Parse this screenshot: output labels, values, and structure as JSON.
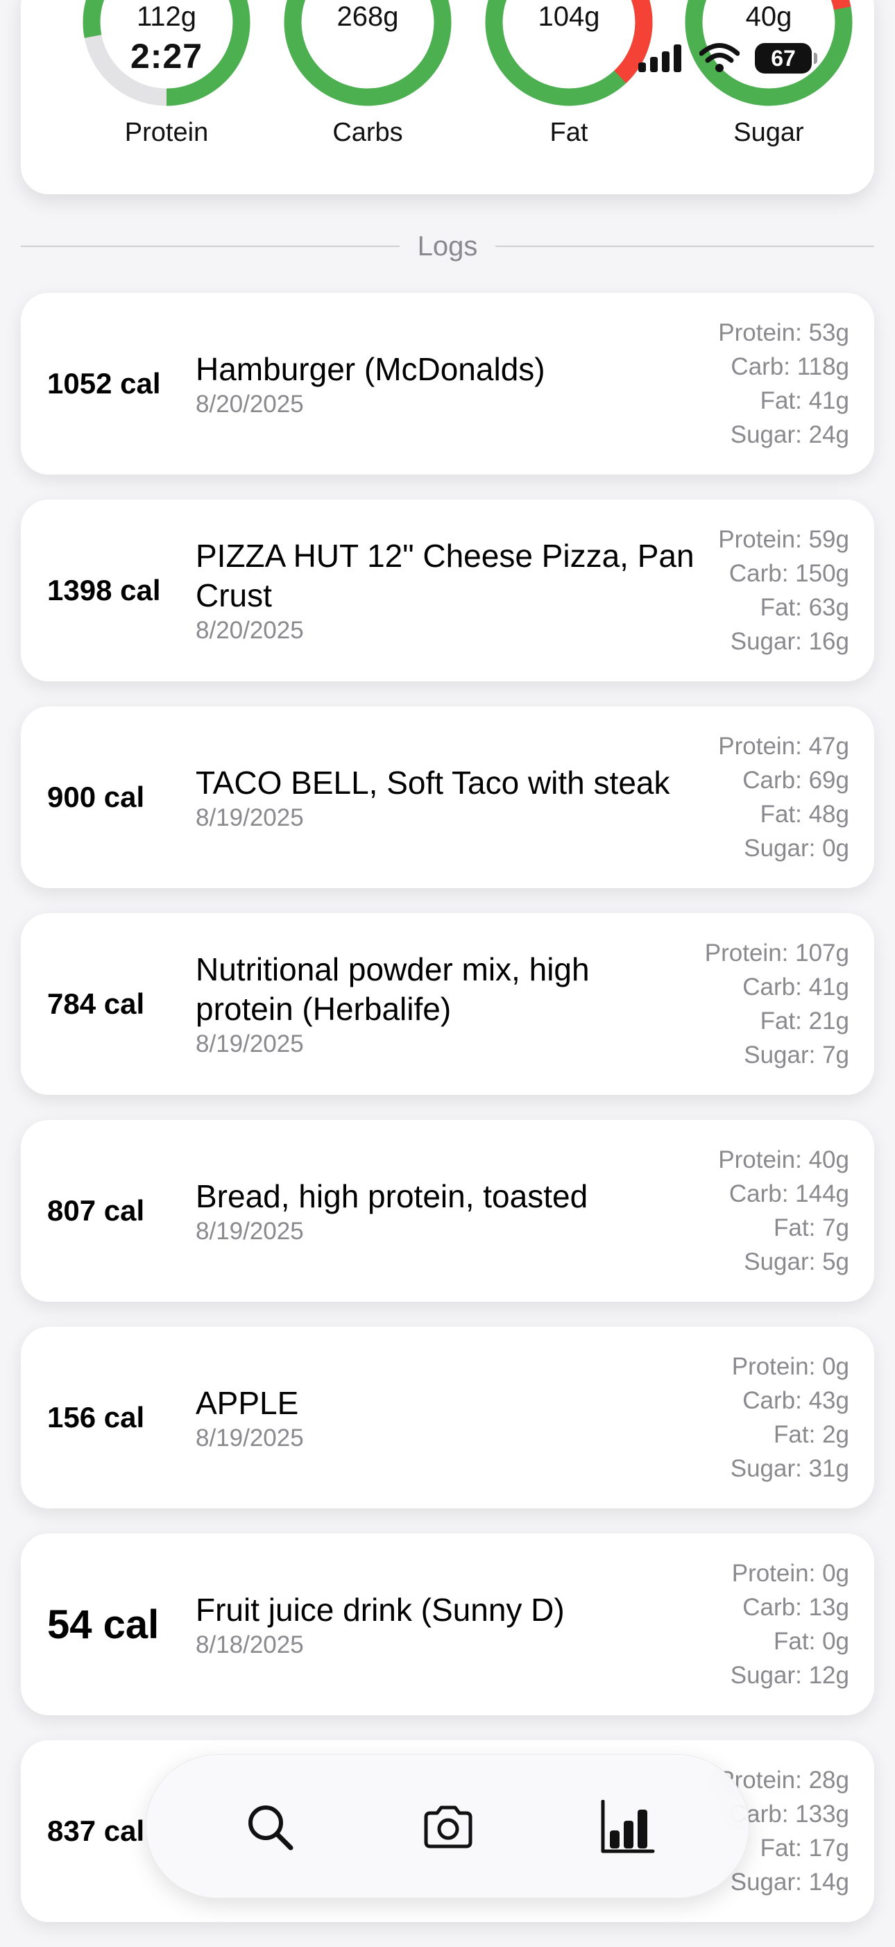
{
  "status_bar": {
    "time": "2:27",
    "battery": "67"
  },
  "macros": [
    {
      "value": "112g",
      "label": "Protein",
      "progress": 0.78,
      "color": "#4caf50",
      "over": false
    },
    {
      "value": "268g",
      "label": "Carbs",
      "progress": 1.0,
      "color": "#4caf50",
      "over": false
    },
    {
      "value": "104g",
      "label": "Fat",
      "progress": 1.0,
      "color": "#4caf50",
      "over": true,
      "over_fraction": 0.38,
      "over_color": "#f44336"
    },
    {
      "value": "40g",
      "label": "Sugar",
      "progress": 1.0,
      "color": "#4caf50",
      "over": true,
      "over_fraction": 0.22,
      "over_color": "#f44336"
    }
  ],
  "logs_header": "Logs",
  "logs": [
    {
      "calories": "1052 cal",
      "name": "Hamburger (McDonalds)",
      "date": "8/20/2025",
      "protein": "Protein: 53g",
      "carb": "Carb: 118g",
      "fat": "Fat: 41g",
      "sugar": "Sugar: 24g"
    },
    {
      "calories": "1398 cal",
      "name": "PIZZA HUT 12\" Cheese Pizza, Pan Crust",
      "date": "8/20/2025",
      "protein": "Protein: 59g",
      "carb": "Carb: 150g",
      "fat": "Fat: 63g",
      "sugar": "Sugar: 16g"
    },
    {
      "calories": "900 cal",
      "name": "TACO BELL, Soft Taco with steak",
      "date": "8/19/2025",
      "protein": "Protein: 47g",
      "carb": "Carb: 69g",
      "fat": "Fat: 48g",
      "sugar": "Sugar: 0g"
    },
    {
      "calories": "784 cal",
      "name": "Nutritional powder mix, high protein (Herbalife)",
      "date": "8/19/2025",
      "protein": "Protein: 107g",
      "carb": "Carb: 41g",
      "fat": "Fat: 21g",
      "sugar": "Sugar: 7g"
    },
    {
      "calories": "807 cal",
      "name": "Bread, high protein, toasted",
      "date": "8/19/2025",
      "protein": "Protein: 40g",
      "carb": "Carb: 144g",
      "fat": "Fat: 7g",
      "sugar": "Sugar: 5g"
    },
    {
      "calories": "156 cal",
      "name": "APPLE",
      "date": "8/19/2025",
      "protein": "Protein: 0g",
      "carb": "Carb: 43g",
      "fat": "Fat: 2g",
      "sugar": "Sugar: 31g"
    },
    {
      "calories": "54 cal",
      "name": "Fruit juice drink (Sunny D)",
      "date": "8/18/2025",
      "protein": "Protein: 0g",
      "carb": "Carb: 13g",
      "fat": "Fat: 0g",
      "sugar": "Sugar: 12g"
    },
    {
      "calories": "837 cal",
      "name": "",
      "date": "",
      "protein": "Protein: 28g",
      "carb": "Carb: 133g",
      "fat": "Fat: 17g",
      "sugar": "Sugar: 14g"
    }
  ],
  "tab_bar": {
    "items": [
      {
        "name": "search-icon"
      },
      {
        "name": "camera-icon"
      },
      {
        "name": "bar-chart-icon"
      }
    ]
  }
}
